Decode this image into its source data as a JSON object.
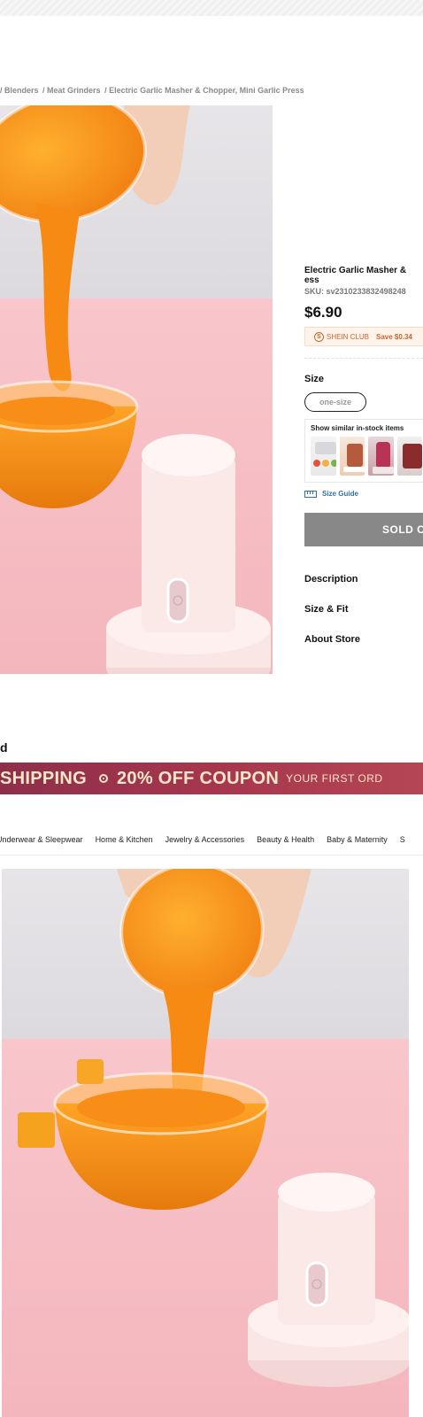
{
  "breadcrumb": [
    "/ Blenders",
    "/ Meat Grinders",
    "/ Electric Garlic Masher & Chopper, Mini Garlic Press"
  ],
  "product": {
    "title_line1": "Electric Garlic Masher &",
    "title_line2": "ess",
    "sku": "SKU: sv2310233832498248",
    "price": "$6.90",
    "club_icon": "S",
    "club_name": "SHEIN CLUB",
    "club_save": "Save $0.34",
    "size_label": "Size",
    "size_option": "one-size",
    "similar_title": "Show similar in-stock items",
    "size_guide": "Size Guide",
    "sold_button": "SOLD O",
    "accordion": [
      "Description",
      "Size & Fit",
      "About Store"
    ]
  },
  "section_heading": "d",
  "banner": {
    "left": "SHIPPING",
    "right": "20% OFF COUPON",
    "small": "YOUR FIRST ORD"
  },
  "categories": [
    "Underwear & Sleepwear",
    "Home & Kitchen",
    "Jewelry & Accessories",
    "Beauty & Health",
    "Baby & Maternity",
    "S"
  ],
  "colors": {
    "banner_start": "#8e2f4a",
    "banner_end": "#b54654",
    "banner_text": "#ffe7c8",
    "club_accent": "#c9662c",
    "link_blue": "#2f6fb0",
    "sold_gray": "#888888"
  }
}
